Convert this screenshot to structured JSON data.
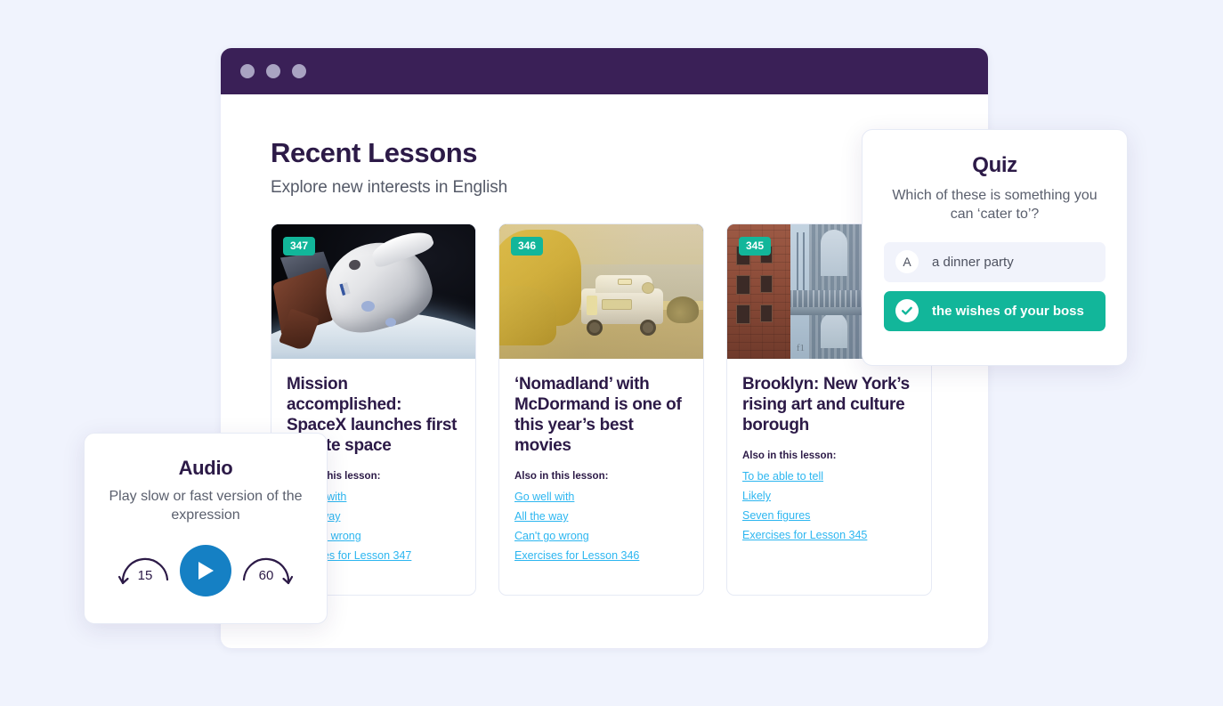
{
  "window": {
    "dots": [
      "dot-1",
      "dot-2",
      "dot-3"
    ]
  },
  "header": {
    "title": "Recent Lessons",
    "subtitle": "Explore new interests in English"
  },
  "lessons": [
    {
      "badge": "347",
      "title": "Mission accomplished: SpaceX launches first private space",
      "also_label": "Also in this lesson:",
      "links": [
        "Go well with",
        "All the way",
        "Can't go wrong",
        "Exercises for Lesson 347"
      ],
      "image_alt": "spacex-dragon-capsule-over-earth"
    },
    {
      "badge": "346",
      "title": "‘Nomadland’ with McDormand is one of this year’s best movies",
      "also_label": "Also in this lesson:",
      "links": [
        "Go well with",
        "All the way",
        "Can't go wrong",
        "Exercises for Lesson 346"
      ],
      "image_alt": "camper-van-at-golden-hour"
    },
    {
      "badge": "345",
      "title": "Brooklyn: New York’s rising art and culture borough",
      "also_label": "Also in this lesson:",
      "links": [
        "To be able to tell",
        "Likely",
        "Seven figures",
        "Exercises for Lesson 345"
      ],
      "image_alt": "manhattan-bridge-from-dumbo"
    }
  ],
  "quiz": {
    "title": "Quiz",
    "question": "Which of these is something you can ‘cater to’?",
    "options": [
      {
        "letter": "A",
        "text": "a dinner party",
        "state": "plain"
      },
      {
        "letter": "",
        "text": "the wishes of your boss",
        "state": "correct"
      }
    ]
  },
  "audio": {
    "title": "Audio",
    "subtitle": "Play slow or fast version of the expression",
    "rewind_value": "15",
    "forward_value": "60",
    "play_icon": "play-icon"
  },
  "colors": {
    "page_bg": "#f0f3fd",
    "titlebar": "#3a2057",
    "heading": "#2c1a47",
    "badge_teal": "#12b69a",
    "link_blue": "#2cb6f0",
    "play_blue": "#1580c4"
  }
}
